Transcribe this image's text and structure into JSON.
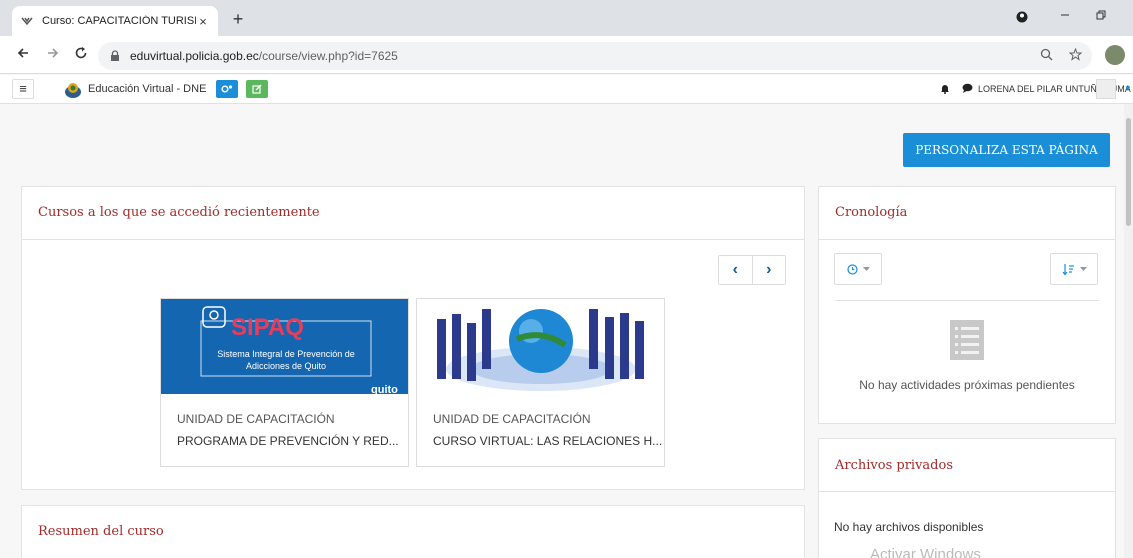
{
  "browser": {
    "tab_title": "Curso: CAPACITACIÓN TURISMO",
    "tab_close": "×",
    "new_tab": "+",
    "url_host": "eduvirtual.policia.gob.ec",
    "url_path": "/course/view.php?id=7625"
  },
  "navbar": {
    "site_name": "Educación Virtual - DNE",
    "user_name": "LORENA DEL PILAR UNTUÑA PUMA"
  },
  "page": {
    "customize_label": "PERSONALIZA ESTA PÁGINA"
  },
  "recent_courses": {
    "title": "Cursos a los que se accedió recientemente",
    "prev_icon": "‹",
    "next_icon": "›",
    "cards": [
      {
        "category": "UNIDAD DE CAPACITACIÓN",
        "name": "PROGRAMA DE PREVENCIÓN Y RED...",
        "image_title": "SIPAQ",
        "image_line1": "Sistema Integral de Prevención de",
        "image_line2": "Adicciones de Quito",
        "image_brand": "quito"
      },
      {
        "category": "UNIDAD DE CAPACITACIÓN",
        "name": "CURSO VIRTUAL: LAS RELACIONES H..."
      }
    ]
  },
  "course_summary": {
    "title": "Resumen del curso"
  },
  "timeline": {
    "title": "Cronología",
    "empty_text": "No hay actividades próximas pendientes"
  },
  "private_files": {
    "title": "Archivos privados",
    "empty_text": "No hay archivos disponibles"
  },
  "watermark": "Activar Windows",
  "colors": {
    "primary": "#1a8fd7",
    "success": "#5cb85c",
    "block_title": "#a52a2a"
  }
}
